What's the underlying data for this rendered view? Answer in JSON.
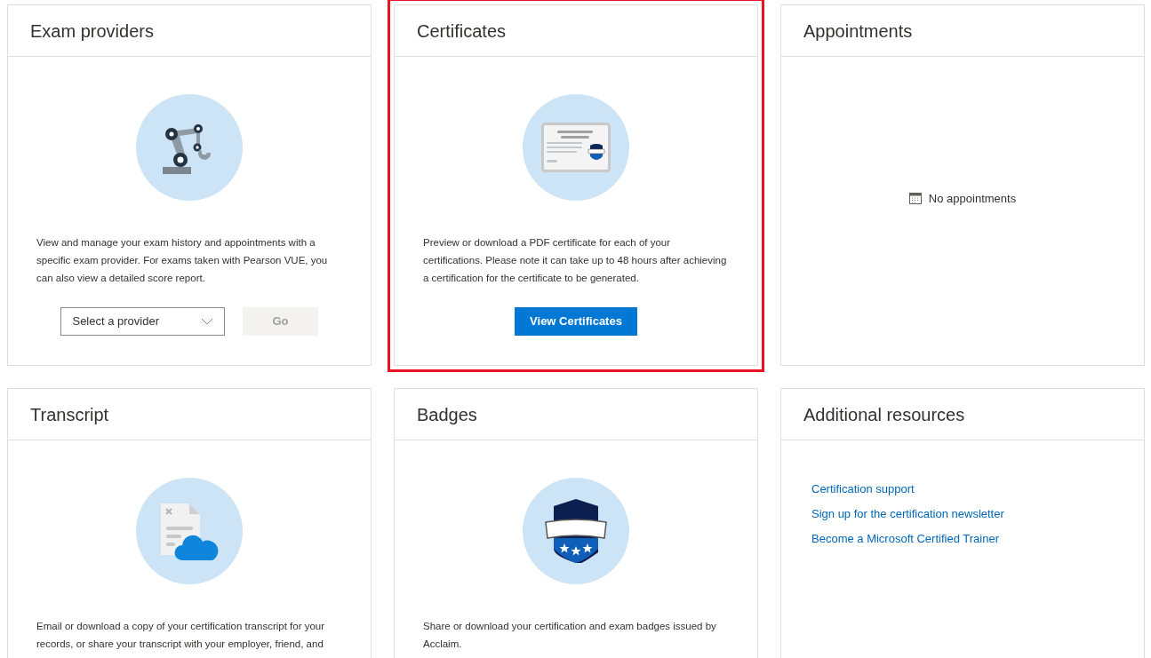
{
  "cards": [
    {
      "kind": "illustrated",
      "title": "Exam providers",
      "highlighted": false,
      "description": "View and manage your exam history and appointments with a specific exam provider. For exams taken with Pearson VUE, you can also view a detailed score report.",
      "select": {
        "placeholder": "Select a provider"
      },
      "button": {
        "label": "Go",
        "disabled": true
      }
    },
    {
      "kind": "illustrated",
      "title": "Certificates",
      "highlighted": true,
      "description": "Preview or download a PDF certificate for each of your certifications. Please note it can take up to 48 hours after achieving a certification for the certificate to be generated.",
      "button": {
        "label": "View Certificates",
        "disabled": false
      }
    },
    {
      "kind": "empty",
      "title": "Appointments",
      "message": "No appointments"
    },
    {
      "kind": "illustrated",
      "title": "Transcript",
      "highlighted": false,
      "description": "Email or download a copy of your certification transcript for your records, or share your transcript with your employer, friend, and"
    },
    {
      "kind": "illustrated",
      "title": "Badges",
      "highlighted": false,
      "description": "Share or download your certification and exam badges issued by Acclaim."
    },
    {
      "kind": "links",
      "title": "Additional resources",
      "links": [
        "Certification support",
        "Sign up for the certification newsletter",
        "Become a Microsoft Certified Trainer"
      ]
    }
  ]
}
